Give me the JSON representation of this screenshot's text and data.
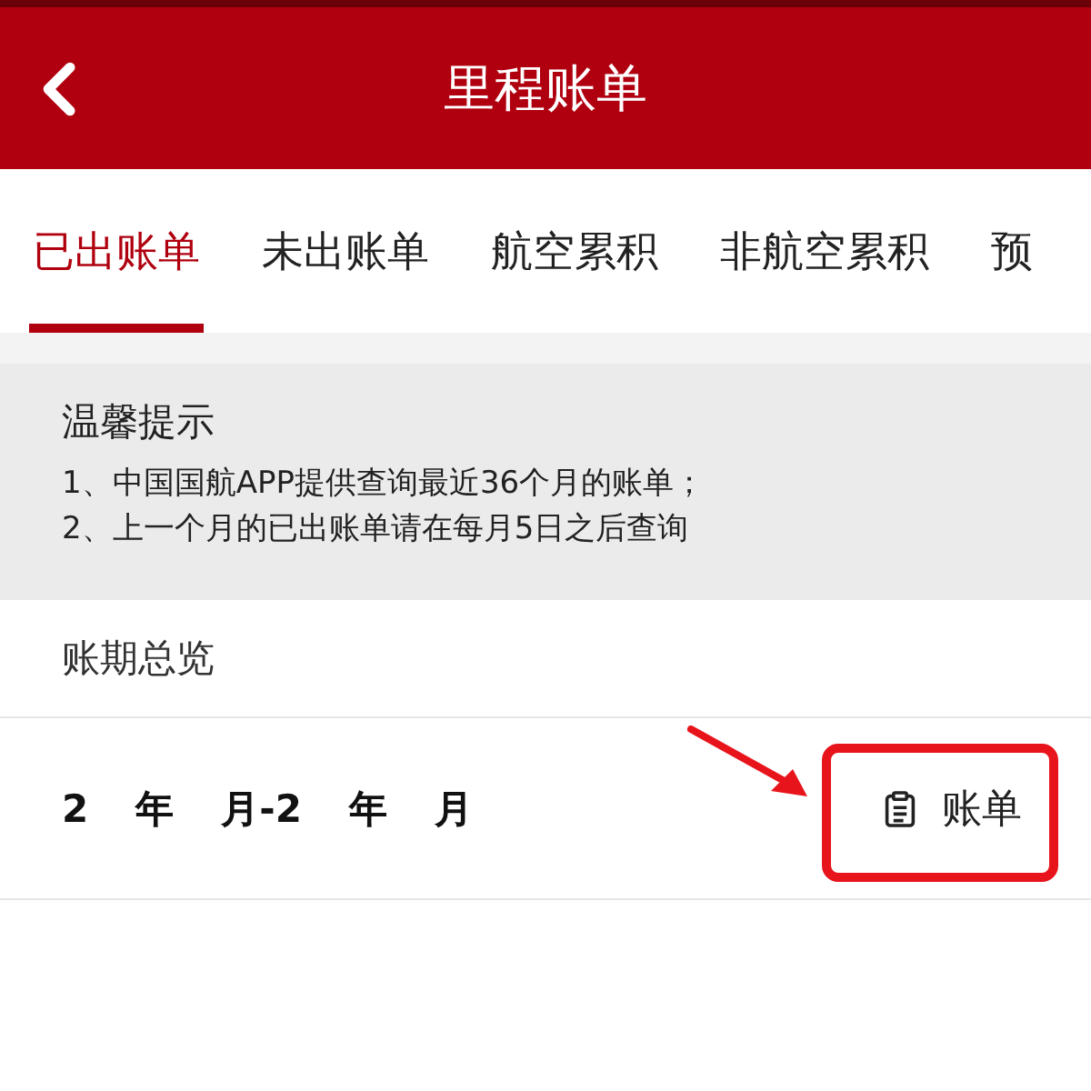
{
  "header": {
    "title": "里程账单"
  },
  "tabs": [
    {
      "label": "已出账单",
      "selected": true
    },
    {
      "label": "未出账单",
      "selected": false
    },
    {
      "label": "航空累积",
      "selected": false
    },
    {
      "label": "非航空累积",
      "selected": false
    },
    {
      "label": "预",
      "selected": false
    }
  ],
  "notice": {
    "title": "温馨提示",
    "lines": [
      "1、中国国航APP提供查询最近36个月的账单；",
      "2、上一个月的已出账单请在每月5日之后查询"
    ]
  },
  "overview": {
    "title": "账期总览"
  },
  "period_row": {
    "date_fragments": [
      "2",
      "年",
      "月-2",
      "年",
      "月"
    ],
    "bill_button": "账单"
  }
}
